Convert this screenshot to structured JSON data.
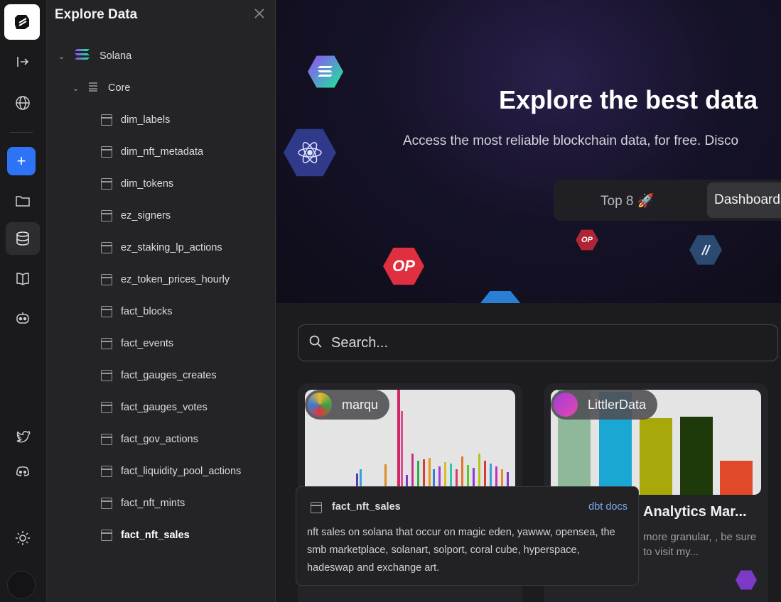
{
  "rail": {
    "items": [
      "logo",
      "expand-icon",
      "globe-icon",
      "add-icon",
      "folder-icon",
      "database-icon",
      "book-icon",
      "bot-icon",
      "twitter-icon",
      "discord-icon",
      "sun-icon"
    ]
  },
  "panel": {
    "title": "Explore Data",
    "chain": "Solana",
    "schema": "Core",
    "tables": [
      "dim_labels",
      "dim_nft_metadata",
      "dim_tokens",
      "ez_signers",
      "ez_staking_lp_actions",
      "ez_token_prices_hourly",
      "fact_blocks",
      "fact_events",
      "fact_gauges_creates",
      "fact_gauges_votes",
      "fact_gov_actions",
      "fact_liquidity_pool_actions",
      "fact_nft_mints",
      "fact_nft_sales"
    ],
    "selected_table": "fact_nft_sales"
  },
  "hero": {
    "title": "Explore the best data",
    "subtitle": "Access the most reliable blockchain data, for free. Disco",
    "toggle_top": "Top 8 🚀",
    "toggle_dashboards": "Dashboards",
    "badges": [
      "OP",
      "OP"
    ]
  },
  "search": {
    "placeholder": "Search..."
  },
  "cards": [
    {
      "author": "marqu",
      "title": "",
      "desc": ""
    },
    {
      "author": "LittlerData",
      "title": "Analytics Mar...",
      "desc": "more granular, , be sure to visit my..."
    }
  ],
  "tooltip": {
    "table": "fact_nft_sales",
    "docs_link": "dbt docs",
    "description": "nft sales on solana that occur on magic eden, yawww, opensea, the smb marketplace, solanart, solport, coral cube, hyperspace, hadeswap and exchange art."
  },
  "colors": {
    "accent": "#2e73f5",
    "docs_link": "#7aa8e8"
  }
}
